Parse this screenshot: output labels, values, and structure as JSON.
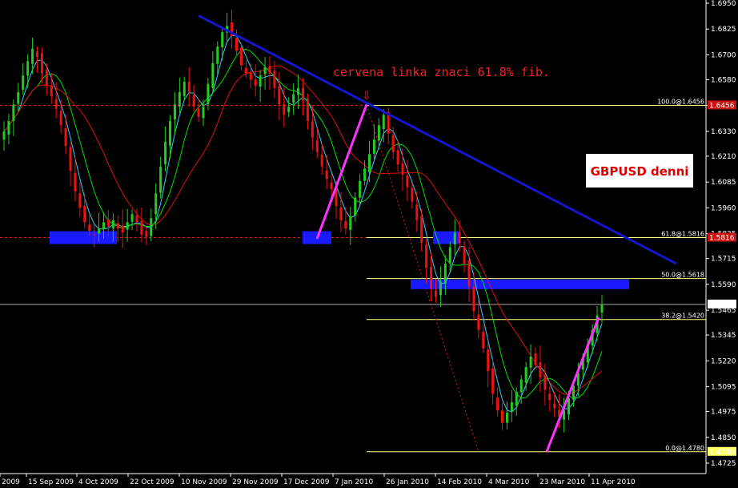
{
  "chart_data": {
    "type": "candlestick",
    "symbol_label": "GBPUSD denni",
    "annotation": "cervena linka znaci 61.8% fib.",
    "annotation_arrow": "⇩",
    "ylim": [
      1.4725,
      1.695
    ],
    "y_ticks": [
      "1.6950",
      "1.6825",
      "1.6700",
      "1.6580",
      "1.6455",
      "1.6330",
      "1.6210",
      "1.6085",
      "1.5960",
      "1.5835",
      "1.5715",
      "1.5590",
      "1.5465",
      "1.5345",
      "1.5220",
      "1.5095",
      "1.4975",
      "1.4850",
      "1.4725"
    ],
    "x_ticks": [
      "2009",
      "15 Sep 2009",
      "4 Oct 2009",
      "22 Oct 2009",
      "10 Nov 2009",
      "29 Nov 2009",
      "17 Dec 2009",
      "7 Jan 2010",
      "26 Jan 2010",
      "14 Feb 2010",
      "4 Mar 2010",
      "23 Mar 2010",
      "11 Apr 2010"
    ],
    "current_price": "1.5493",
    "fib_levels": [
      {
        "label": "100.0@1.6456",
        "value": 1.6456,
        "tag": "1.6456"
      },
      {
        "label": "61.8@1.5816",
        "value": 1.5816,
        "tag": "1.5816"
      },
      {
        "label": "50.0@1.5618",
        "value": 1.5618
      },
      {
        "label": "38.2@1.5420",
        "value": 1.542
      },
      {
        "label": "0.0@1.4780",
        "value": 1.478,
        "tag": "1.4780"
      }
    ],
    "trendline": {
      "from": {
        "date": "10 Nov 2009",
        "price": 1.689
      },
      "to": {
        "date": "16 Apr 2010",
        "price": 1.569
      }
    },
    "support_zones": [
      {
        "from": "5 Sep 2009",
        "to": "15 Oct 2009",
        "price": 1.5816
      },
      {
        "from": "22 Dec 2009",
        "to": "5 Jan 2010",
        "price": 1.5816
      },
      {
        "from": "9 Feb 2010",
        "to": "17 Feb 2010",
        "price": 1.5816
      },
      {
        "from": "30 Jan 2010",
        "to": "15 Apr 2010",
        "price": 1.559
      }
    ],
    "swing_lines": [
      {
        "from": {
          "date": "24 Dec 2009",
          "price": 1.581
        },
        "to": {
          "date": "12 Jan 2010",
          "price": 1.646
        }
      },
      {
        "from": {
          "date": "25 Mar 2010",
          "price": 1.478
        },
        "to": {
          "date": "13 Apr 2010",
          "price": 1.543
        }
      }
    ],
    "colors": {
      "bull": "#22cc22",
      "bear": "#ee1111",
      "trend": "#1515cc",
      "zone": "#1a1aff",
      "swing": "#ff33ff",
      "fib_red": "#cc2222",
      "fib_yellow": "#ffff88",
      "annotation": "#ee2222",
      "ma_fast": "#33ccff",
      "ma_mid": "#00dd00",
      "ma_slow": "#dd1111"
    },
    "closes": [
      1.633,
      1.638,
      1.646,
      1.652,
      1.66,
      1.667,
      1.673,
      1.669,
      1.661,
      1.655,
      1.65,
      1.644,
      1.636,
      1.626,
      1.614,
      1.604,
      1.596,
      1.589,
      1.585,
      1.583,
      1.586,
      1.589,
      1.587,
      1.59,
      1.586,
      1.584,
      1.589,
      1.593,
      1.589,
      1.583,
      1.582,
      1.591,
      1.603,
      1.616,
      1.628,
      1.638,
      1.646,
      1.652,
      1.657,
      1.652,
      1.645,
      1.64,
      1.645,
      1.656,
      1.666,
      1.674,
      1.681,
      1.684,
      1.679,
      1.672,
      1.665,
      1.661,
      1.658,
      1.655,
      1.66,
      1.664,
      1.661,
      1.654,
      1.646,
      1.641,
      1.645,
      1.651,
      1.654,
      1.648,
      1.638,
      1.63,
      1.623,
      1.616,
      1.61,
      1.605,
      1.597,
      1.59,
      1.586,
      1.592,
      1.601,
      1.609,
      1.615,
      1.622,
      1.629,
      1.636,
      1.641,
      1.632,
      1.623,
      1.617,
      1.612,
      1.606,
      1.599,
      1.59,
      1.579,
      1.567,
      1.557,
      1.553,
      1.56,
      1.569,
      1.577,
      1.584,
      1.579,
      1.569,
      1.558,
      1.546,
      1.537,
      1.528,
      1.517,
      1.506,
      1.498,
      1.492,
      1.497,
      1.502,
      1.507,
      1.513,
      1.519,
      1.524,
      1.52,
      1.514,
      1.508,
      1.503,
      1.499,
      1.495,
      1.498,
      1.504,
      1.51,
      1.516,
      1.523,
      1.53,
      1.537,
      1.544,
      1.549
    ]
  }
}
